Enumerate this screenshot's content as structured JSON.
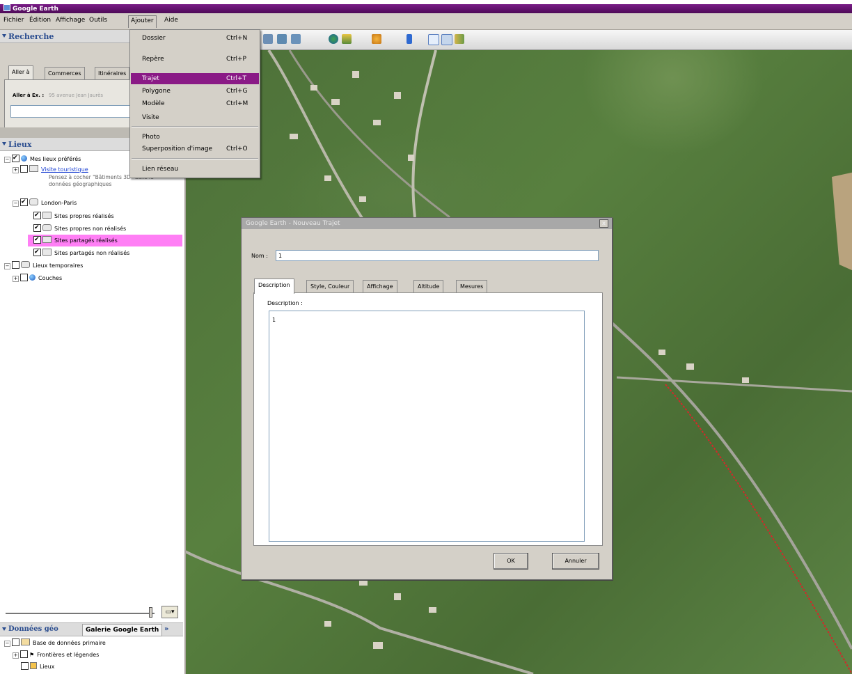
{
  "window": {
    "title": "Google Earth"
  },
  "menubar": {
    "items": [
      "Fichier",
      "Édition",
      "Affichage",
      "Outils",
      "Ajouter",
      "Aide"
    ]
  },
  "add_menu": {
    "items": [
      {
        "label": "Dossier",
        "shortcut": "Ctrl+N"
      },
      {
        "label": "Repère",
        "shortcut": "Ctrl+P"
      },
      {
        "label": "Trajet",
        "shortcut": "Ctrl+T",
        "selected": true
      },
      {
        "label": "Polygone",
        "shortcut": "Ctrl+G"
      },
      {
        "label": "Modèle",
        "shortcut": "Ctrl+M"
      },
      {
        "label": "Visite",
        "shortcut": ""
      },
      {
        "label": "Photo",
        "shortcut": ""
      },
      {
        "label": "Superposition d'image",
        "shortcut": "Ctrl+O"
      },
      {
        "label": "Lien réseau",
        "shortcut": ""
      }
    ]
  },
  "search_panel": {
    "header": "Recherche",
    "tabs": [
      "Aller à",
      "Commerces",
      "Itinéraires"
    ],
    "goto_label": "Aller à Ex. :",
    "goto_example": "95 avenue Jean Jaurès",
    "input_value": ""
  },
  "places_panel": {
    "header": "Lieux",
    "tree": {
      "my_places": "Mes lieux préférés",
      "tour": "Visite touristique",
      "tour_hint_1": "Pensez à cocher \"Bâtiments 3D\" dans le",
      "tour_hint_2": "données géographiques",
      "london_paris": "London-Paris",
      "sites_1": "Sites propres réalisés",
      "sites_2": "Sites propres non réalisés",
      "sites_3": "Sites partagés réalisés",
      "sites_4": "Sites partagés non réalisés",
      "temp": "Lieux temporaires",
      "layers": "Couches"
    }
  },
  "layers_panel": {
    "tab_active": "Données géo",
    "tab_other": "Galerie Google Earth",
    "tab_more": "»",
    "items": [
      "Base de données primaire",
      "Frontières et légendes",
      "Lieux"
    ]
  },
  "dialog": {
    "title": "Google Earth - Nouveau Trajet",
    "name_label": "Nom :",
    "name_value": "1",
    "tabs": [
      "Description",
      "Style, Couleur",
      "Affichage",
      "Altitude",
      "Mesures"
    ],
    "description_label": "Description :",
    "description_value": "1",
    "ok_label": "OK",
    "cancel_label": "Annuler",
    "close_glyph": "x"
  },
  "colors": {
    "title_bar": "#6a1479",
    "menu_highlight": "#8a1a86",
    "header_text": "#2b4d8f",
    "selected_tree_row": "#ff7ff5"
  },
  "icons": {
    "toolbar": [
      "placemark-icon",
      "polygon-icon",
      "path-icon",
      "overlay-icon",
      "record-tour-icon",
      "historical-imagery-icon",
      "sun-icon",
      "planets-icon",
      "ruler-icon",
      "email-icon",
      "print-icon",
      "view-in-maps-icon"
    ]
  }
}
